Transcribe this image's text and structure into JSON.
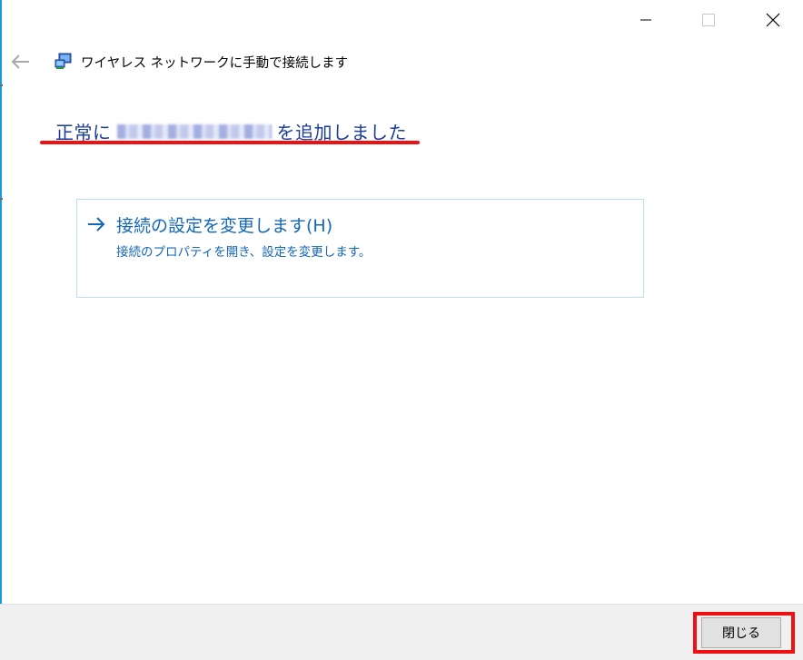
{
  "window": {
    "title": "ワイヤレス ネットワークに手動で接続します",
    "icons": {
      "minimize": "minimize-icon",
      "maximize": "maximize-icon",
      "close": "close-icon",
      "back": "back-arrow-icon",
      "network": "network-icon"
    }
  },
  "content": {
    "heading_prefix": "正常に",
    "heading_suffix": "を追加しました",
    "heading_color": "#1a3d99",
    "highlight_color": "#ee1111",
    "command_link": {
      "title": "接続の設定を変更します(H)",
      "description": "接続のプロパティを開き、設定を変更します。",
      "icon": "arrow-right-icon",
      "color": "#1467b8"
    }
  },
  "footer": {
    "close_label": "閉じる"
  }
}
